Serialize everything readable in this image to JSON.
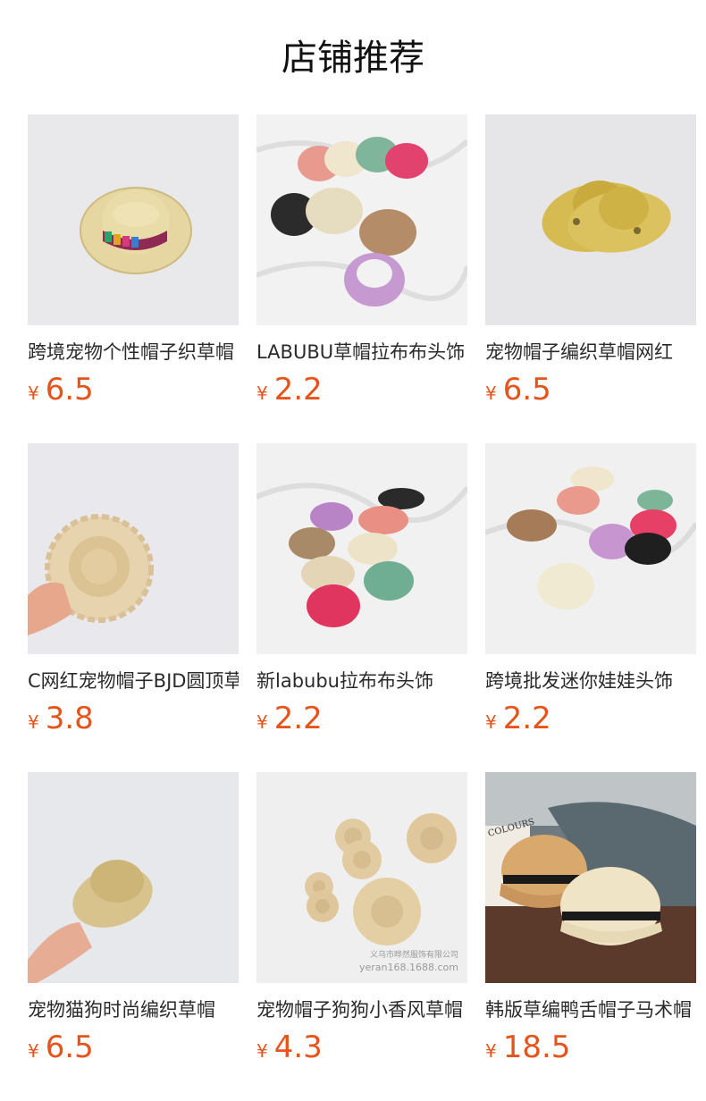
{
  "header": {
    "title": "店铺推荐"
  },
  "products": [
    {
      "name": "跨境宠物个性帽子织草帽",
      "currency": "¥",
      "price": "6.5",
      "image": "straw-fedora-rainbow-band-photo"
    },
    {
      "name": "LABUBU草帽拉布布头饰",
      "currency": "¥",
      "price": "2.2",
      "image": "colorful-sun-visors-photo"
    },
    {
      "name": "宠物帽子编织草帽网红",
      "currency": "¥",
      "price": "6.5",
      "image": "cowboy-straw-hat-photo"
    },
    {
      "name": "C网红宠物帽子BJD圆顶草帽",
      "currency": "¥",
      "price": "3.8",
      "image": "lace-brim-straw-hat-in-hand-photo"
    },
    {
      "name": "新labubu拉布布头饰",
      "currency": "¥",
      "price": "2.2",
      "image": "colorful-mini-boaters-photo"
    },
    {
      "name": "跨境批发迷你娃娃头饰",
      "currency": "¥",
      "price": "2.2",
      "image": "mixed-mini-hats-photo"
    },
    {
      "name": "宠物猫狗时尚编织草帽",
      "currency": "¥",
      "price": "6.5",
      "image": "straw-fedora-in-hand-photo"
    },
    {
      "name": "宠物帽子狗狗小香风草帽",
      "currency": "¥",
      "price": "4.3",
      "image": "mini-boater-hats-watermark-photo",
      "watermark": [
        "义乌市晔然服饰有限公司",
        "yeran168.1688.com"
      ]
    },
    {
      "name": "韩版草编鸭舌帽子马术帽",
      "currency": "¥",
      "price": "18.5",
      "image": "straw-visor-caps-on-table-photo",
      "cover_text": "COLOURS"
    }
  ],
  "colors": {
    "price": "#e4541c",
    "title": "#111111"
  }
}
